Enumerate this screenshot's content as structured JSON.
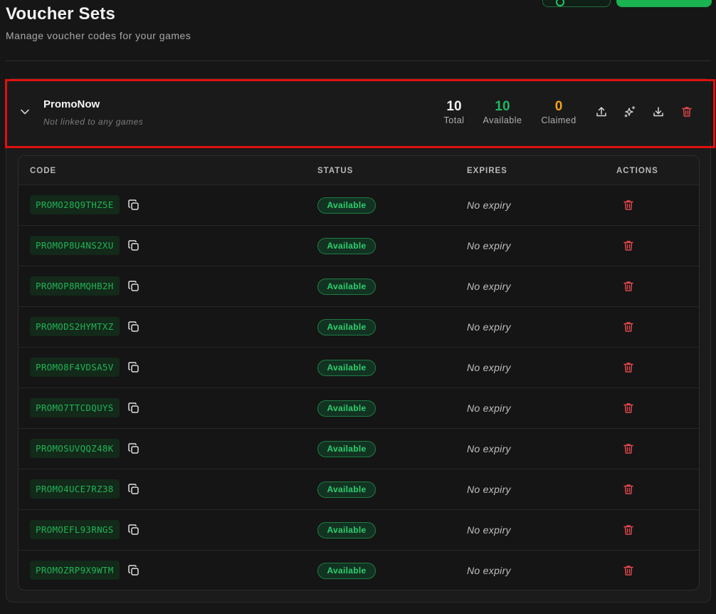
{
  "page": {
    "title": "Voucher Sets",
    "subtitle": "Manage voucher codes for your games"
  },
  "voucher_set": {
    "name": "PromoNow",
    "linked_games": "Not linked to any games",
    "stats": {
      "total": {
        "value": "10",
        "label": "Total",
        "color": "#f2f2f2"
      },
      "available": {
        "value": "10",
        "label": "Available",
        "color": "#22b565"
      },
      "claimed": {
        "value": "0",
        "label": "Claimed",
        "color": "#f5a21b"
      }
    },
    "actions": [
      "upload-icon",
      "sparkles-icon",
      "download-icon",
      "trash-icon"
    ]
  },
  "table": {
    "columns": {
      "code": "CODE",
      "status": "STATUS",
      "expires": "EXPIRES",
      "actions": "ACTIONS"
    },
    "rows": [
      {
        "code": "PROMO28Q9THZ5E",
        "status": "Available",
        "expires": "No expiry"
      },
      {
        "code": "PROMOP8U4NS2XU",
        "status": "Available",
        "expires": "No expiry"
      },
      {
        "code": "PROMOP8RMQHB2H",
        "status": "Available",
        "expires": "No expiry"
      },
      {
        "code": "PROMODS2HYMTXZ",
        "status": "Available",
        "expires": "No expiry"
      },
      {
        "code": "PROMO8F4VDSA5V",
        "status": "Available",
        "expires": "No expiry"
      },
      {
        "code": "PROMO7TTCDQUYS",
        "status": "Available",
        "expires": "No expiry"
      },
      {
        "code": "PROMOSUVQQZ48K",
        "status": "Available",
        "expires": "No expiry"
      },
      {
        "code": "PROMO4UCE7RZ38",
        "status": "Available",
        "expires": "No expiry"
      },
      {
        "code": "PROMOEFL93RNGS",
        "status": "Available",
        "expires": "No expiry"
      },
      {
        "code": "PROMOZRP9X9WTM",
        "status": "Available",
        "expires": "No expiry"
      }
    ]
  },
  "colors": {
    "accent_green": "#19b350",
    "danger_red": "#e5484d",
    "highlight_border": "#e01010"
  }
}
